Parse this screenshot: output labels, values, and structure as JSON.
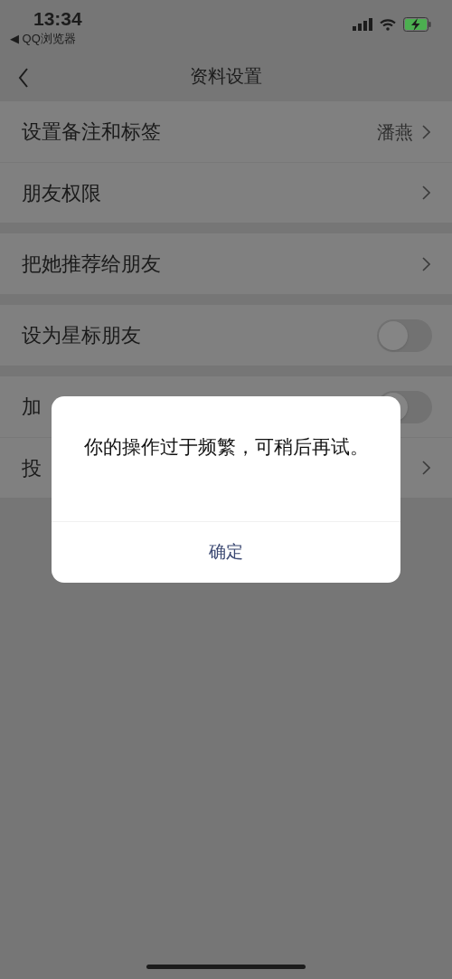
{
  "status_bar": {
    "time": "13:34",
    "back_app": "◀ QQ浏览器"
  },
  "nav": {
    "title": "资料设置"
  },
  "groups": [
    [
      {
        "kind": "link",
        "label": "设置备注和标签",
        "value": "潘燕"
      },
      {
        "kind": "link",
        "label": "朋友权限"
      }
    ],
    [
      {
        "kind": "link",
        "label": "把她推荐给朋友"
      }
    ],
    [
      {
        "kind": "toggle",
        "label": "设为星标朋友",
        "on": false
      }
    ],
    [
      {
        "kind": "toggle",
        "label": "加",
        "on": false
      },
      {
        "kind": "link",
        "label": "投"
      }
    ]
  ],
  "dialog": {
    "message": "你的操作过于频繁，可稍后再试。",
    "button": "确定"
  }
}
